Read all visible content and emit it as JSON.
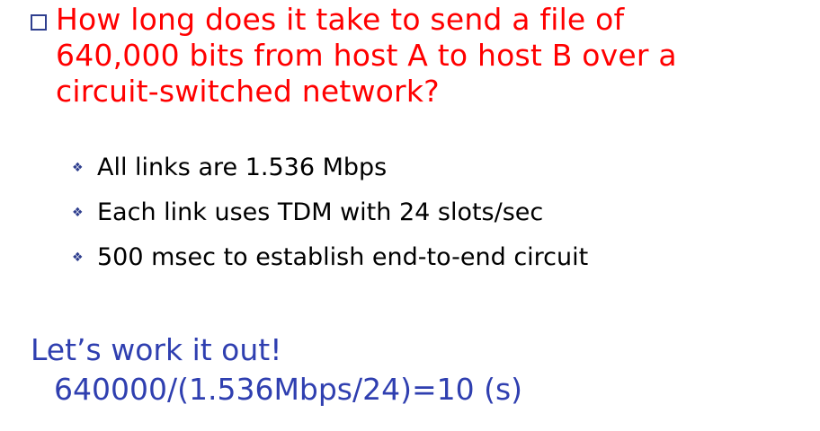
{
  "question": {
    "lines": [
      "How long does it take to send a file of",
      "640,000 bits from host A to host B over a",
      "circuit-switched network?"
    ],
    "color": "#ff0000",
    "bullet_icon": "square-bullet-icon"
  },
  "sub_points": [
    {
      "icon": "diamond-bullet-icon",
      "text": "All links are 1.536 Mbps"
    },
    {
      "icon": "diamond-bullet-icon",
      "text": "Each link uses TDM with 24 slots/sec"
    },
    {
      "icon": "diamond-bullet-icon",
      "text": "500 msec to establish end-to-end circuit"
    }
  ],
  "answer": {
    "heading": "Let’s work it out!",
    "calculation": "640000/(1.536Mbps/24)=10 (s)",
    "color": "#2f3fb0"
  }
}
